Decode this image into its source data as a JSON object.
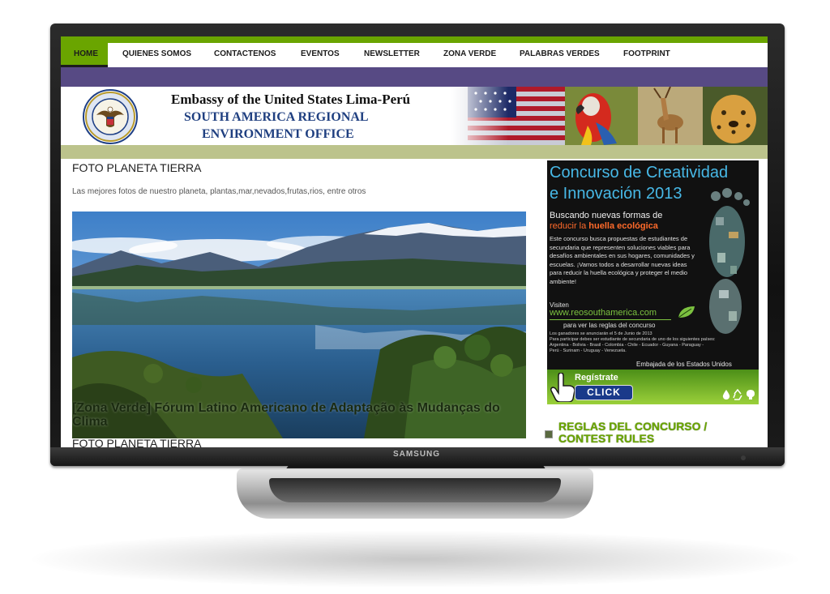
{
  "monitor": {
    "brand": "SAMSUNG"
  },
  "nav": {
    "items": [
      "HOME",
      "QUIENES SOMOS",
      "CONTACTENOS",
      "EVENTOS",
      "NEWSLETTER",
      "ZONA VERDE",
      "PALABRAS VERDES",
      "FOOTPRINT"
    ],
    "active": "HOME"
  },
  "banner": {
    "line1": "Embassy of the United States Lima-Perú",
    "line2": "SOUTH AMERICA REGIONAL",
    "line3": "ENVIRONMENT OFFICE",
    "seal_text": "DEPARTMENT OF STATE · UNITED STATES OF AMERICA"
  },
  "main": {
    "title": "FOTO PLANETA TIERRA",
    "description": "Las mejores fotos de nuestro planeta, plantas,mar,nevados,frutas,rios, entre otros",
    "caption": "[Zona Verde] Fórum Latino Americano de Adaptação às Mudanças do Clima",
    "title_repeat": "FOTO PLANETA TIERRA"
  },
  "ad": {
    "title1": "Concurso de Creatividad",
    "title2": "e Innovación 2013",
    "sub1": "Buscando nuevas formas de",
    "sub2a": "reducir la ",
    "sub2b": "huella ecológica",
    "body": "Este concurso busca propuestas de estudiantes de secundaria que representen soluciones viables para desafíos ambientales en sus hogares, comunidades y escuelas. ¡Vamos todos a desarrollar nuevas ideas para reducir la huella ecológica y proteger el medio ambiente!",
    "visit": "Visiten",
    "url": "www.reosouthamerica.com",
    "rules": "para ver las reglas del concurso",
    "fine1": "Los ganadores se anunciarán el 5 de Junio de 2013",
    "fine2": "Para participar debes ser estudiante de secundaria de uno de los siguientes países:",
    "fine3": "Argentina - Bolivia - Brasil - Colombia - Chile - Ecuador - Guyana - Paraguay -",
    "fine4": "Perú - Surinam - Uruguay - Venezuela.",
    "embassy": "Embajada de los Estados Unidos",
    "register": "Regístrate",
    "click": "CLICK"
  },
  "sidebar": {
    "rules_link": "REGLAS DEL CONCURSO / CONTEST RULES"
  }
}
